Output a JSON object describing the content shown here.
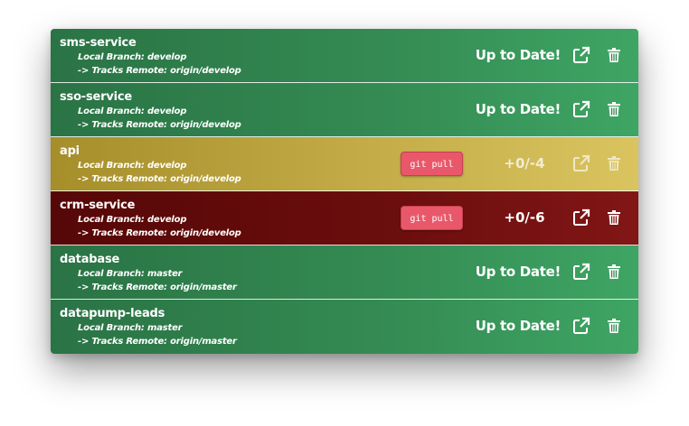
{
  "repos": [
    {
      "name": "sms-service",
      "branch": "Local Branch: develop",
      "remote": "-> Tracks Remote: origin/develop",
      "status": "Up to Date!",
      "diff": "",
      "action": "",
      "state": "green"
    },
    {
      "name": "sso-service",
      "branch": "Local Branch: develop",
      "remote": "-> Tracks Remote: origin/develop",
      "status": "Up to Date!",
      "diff": "",
      "action": "",
      "state": "green"
    },
    {
      "name": "api",
      "branch": "Local Branch: develop",
      "remote": "-> Tracks Remote: origin/develop",
      "status": "",
      "diff": "+0/-4",
      "action": "git pull",
      "state": "yellow"
    },
    {
      "name": "crm-service",
      "branch": "Local Branch: develop",
      "remote": "-> Tracks Remote: origin/develop",
      "status": "",
      "diff": "+0/-6",
      "action": "git pull",
      "state": "red"
    },
    {
      "name": "database",
      "branch": "Local Branch: master",
      "remote": "-> Tracks Remote: origin/master",
      "status": "Up to Date!",
      "diff": "",
      "action": "",
      "state": "green"
    },
    {
      "name": "datapump-leads",
      "branch": "Local Branch: master",
      "remote": "-> Tracks Remote: origin/master",
      "status": "Up to Date!",
      "diff": "",
      "action": "",
      "state": "green"
    }
  ],
  "icons": {
    "open": "external-link-icon",
    "delete": "trash-icon"
  },
  "colors": {
    "up_to_date": "#3a9a5c",
    "behind": "#c4ad48",
    "error": "#6a0d0d",
    "git_pull_button": "#e9586a"
  }
}
